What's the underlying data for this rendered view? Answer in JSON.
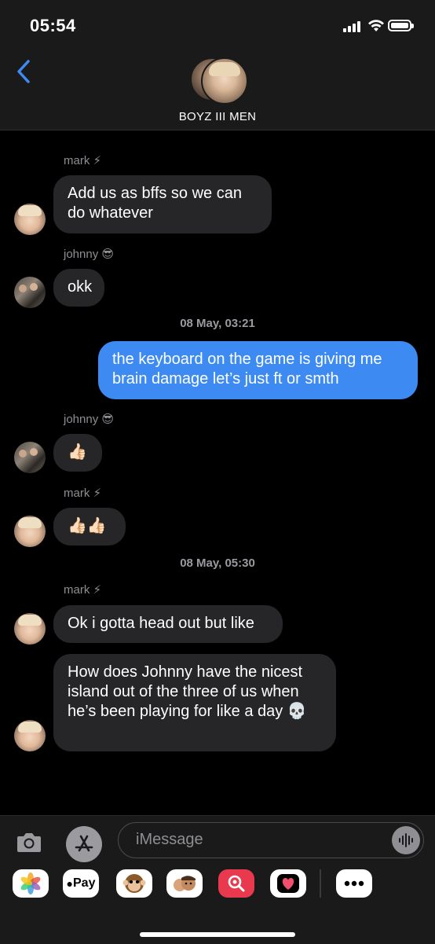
{
  "status": {
    "time": "05:54"
  },
  "header": {
    "group_name": "BOYZ III MEN"
  },
  "messages": [
    {
      "sender": "mark ⚡",
      "text": "Add us as bffs so we can do whatever"
    },
    {
      "sender": "johnny 😎",
      "text": "okk"
    },
    {
      "timestamp": "08 May, 03:21"
    },
    {
      "text": "the keyboard on the game is giving me brain damage let’s just ft or smth"
    },
    {
      "sender": "johnny 😎",
      "text": "👍🏻"
    },
    {
      "sender": "mark ⚡",
      "text": "👍🏻👍🏻"
    },
    {
      "timestamp": "08 May, 05:30"
    },
    {
      "sender": "mark ⚡",
      "text": "Ok i gotta head out but like"
    },
    {
      "text": "How does Johnny have the nicest island out of the three of us when he’s been playing for like a day 💀"
    }
  ],
  "input": {
    "placeholder": "iMessage"
  },
  "apps": {
    "pay_label": "Pay"
  }
}
